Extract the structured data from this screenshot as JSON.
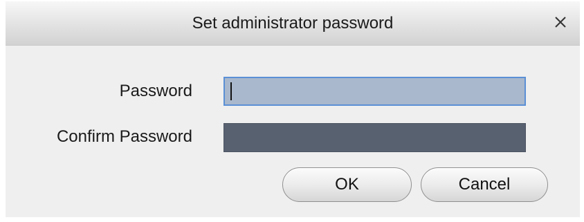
{
  "dialog": {
    "title": "Set administrator password",
    "close_icon": "close-icon",
    "fields": {
      "password_label": "Password",
      "password_value": "",
      "confirm_label": "Confirm Password",
      "confirm_value": ""
    },
    "buttons": {
      "ok_label": "OK",
      "cancel_label": "Cancel"
    }
  },
  "colors": {
    "password_field_bg": "#a9b8cc",
    "password_field_border": "#5b8fd6",
    "confirm_field_bg": "#586170",
    "dialog_bg": "#efefef"
  }
}
